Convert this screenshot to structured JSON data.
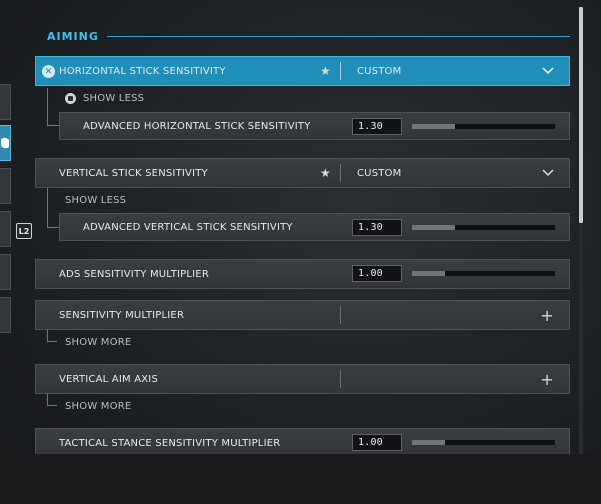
{
  "section": {
    "title": "AIMING"
  },
  "rail": {
    "badge": "L2"
  },
  "rows": {
    "horizontal": {
      "label": "HORIZONTAL STICK SENSITIVITY",
      "value": "CUSTOM"
    },
    "horizontal_toggle": {
      "label": "SHOW LESS"
    },
    "adv_horizontal": {
      "label": "ADVANCED HORIZONTAL STICK SENSITIVITY",
      "value": "1.30",
      "fill_fraction": 0.3
    },
    "vertical": {
      "label": "VERTICAL STICK SENSITIVITY",
      "value": "CUSTOM"
    },
    "vertical_toggle": {
      "label": "SHOW LESS"
    },
    "adv_vertical": {
      "label": "ADVANCED VERTICAL STICK SENSITIVITY",
      "value": "1.30",
      "fill_fraction": 0.3
    },
    "ads": {
      "label": "ADS SENSITIVITY MULTIPLIER",
      "value": "1.00",
      "fill_fraction": 0.23
    },
    "sens_mult": {
      "label": "SENSITIVITY MULTIPLIER"
    },
    "sens_mult_toggle": {
      "label": "SHOW MORE"
    },
    "vertical_aim": {
      "label": "VERTICAL AIM AXIS"
    },
    "vertical_aim_toggle": {
      "label": "SHOW MORE"
    },
    "tactical": {
      "label": "TACTICAL STANCE SENSITIVITY MULTIPLIER",
      "value": "1.00",
      "fill_fraction": 0.23
    }
  },
  "colors": {
    "accent": "#1f8fba",
    "header": "#3fc3ea"
  }
}
